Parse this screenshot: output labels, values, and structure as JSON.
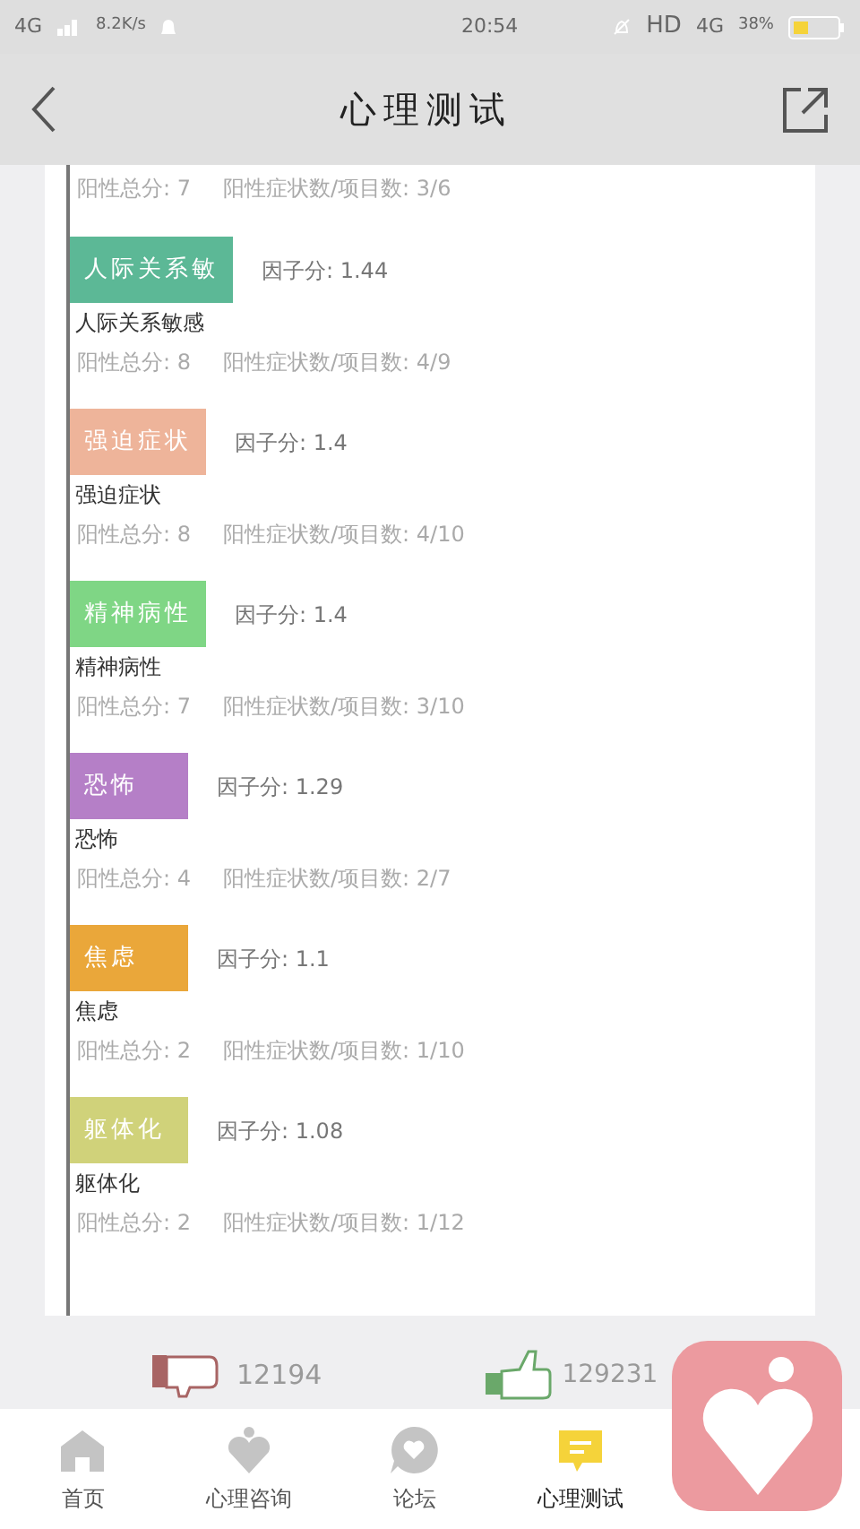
{
  "status_bar": {
    "network_left": "4G",
    "speed": "8.2K/s",
    "time": "20:54",
    "hd": "HD",
    "network_right": "4G",
    "battery": "38%"
  },
  "header": {
    "title": "心理测试"
  },
  "partial_row": {
    "positive_total": "阳性总分: 7",
    "ratio": "阳性症状数/项目数: 3/6"
  },
  "factors": [
    {
      "label": "人际关系敏",
      "color": "#5cb896",
      "factor_score": "因子分: 1.44",
      "name": "人际关系敏感",
      "positive_total": "阳性总分: 8",
      "ratio": "阳性症状数/项目数: 4/9"
    },
    {
      "label": "强迫症状",
      "color": "#eeb49a",
      "factor_score": "因子分: 1.4",
      "name": "强迫症状",
      "positive_total": "阳性总分: 8",
      "ratio": "阳性症状数/项目数: 4/10"
    },
    {
      "label": "精神病性",
      "color": "#7fd685",
      "factor_score": "因子分: 1.4",
      "name": "精神病性",
      "positive_total": "阳性总分: 7",
      "ratio": "阳性症状数/项目数: 3/10"
    },
    {
      "label": "恐怖",
      "color": "#b57fc7",
      "factor_score": "因子分: 1.29",
      "name": "恐怖",
      "positive_total": "阳性总分: 4",
      "ratio": "阳性症状数/项目数: 2/7"
    },
    {
      "label": "焦虑",
      "color": "#eaa73a",
      "factor_score": "因子分: 1.1",
      "name": "焦虑",
      "positive_total": "阳性总分: 2",
      "ratio": "阳性症状数/项目数: 1/10"
    },
    {
      "label": "躯体化",
      "color": "#d0d27a",
      "factor_score": "因子分: 1.08",
      "name": "躯体化",
      "positive_total": "阳性总分: 2",
      "ratio": "阳性症状数/项目数: 1/12"
    }
  ],
  "votes": {
    "dislikes": "12194",
    "likes": "129231"
  },
  "tabs": [
    {
      "kind": "home",
      "label": "首页",
      "selected": false
    },
    {
      "kind": "consult",
      "label": "心理咨询",
      "selected": false
    },
    {
      "kind": "forum",
      "label": "论坛",
      "selected": false
    },
    {
      "kind": "test",
      "label": "心理测试",
      "selected": true
    }
  ]
}
